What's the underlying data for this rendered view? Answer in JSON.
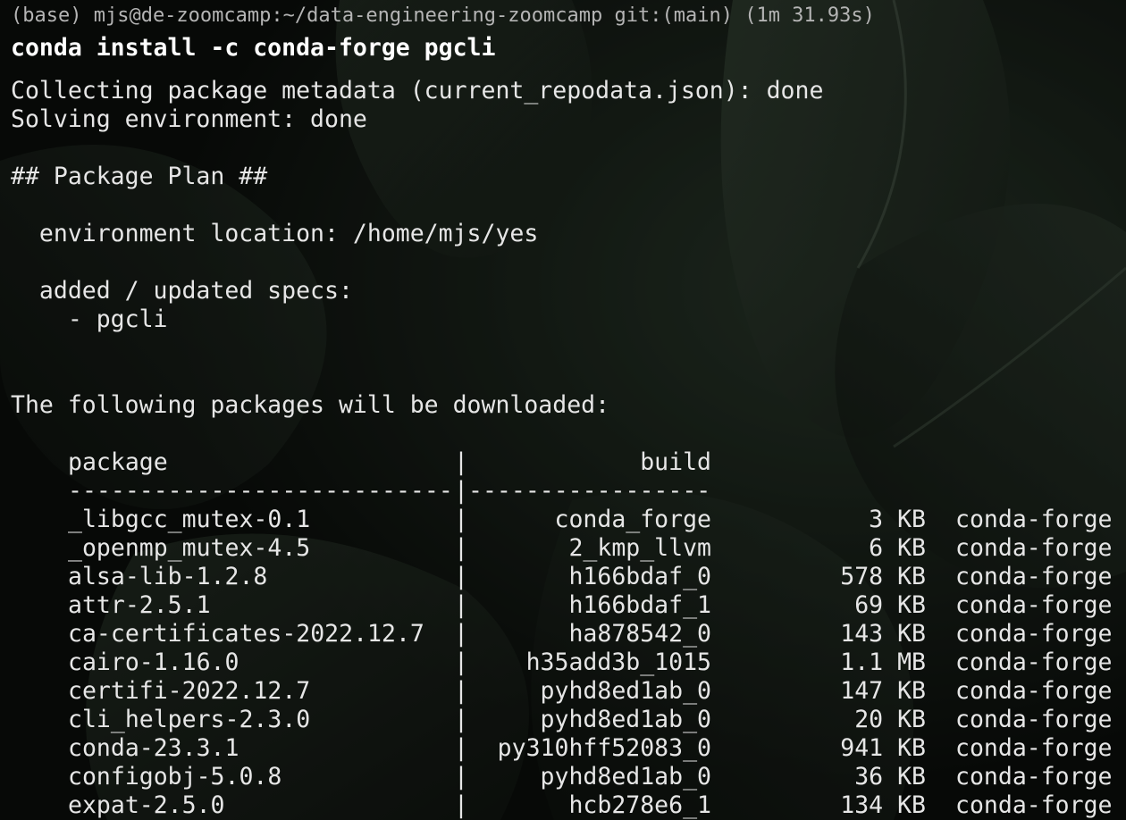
{
  "terminal": {
    "prompt": "(base) mjs@de-zoomcamp:~/data-engineering-zoomcamp git:(main) (1m 31.93s)",
    "command": "conda install -c conda-forge pgcli",
    "output_lines": [
      "Collecting package metadata (current_repodata.json): done",
      "Solving environment: done",
      "## Package Plan ##",
      "  environment location: /home/mjs/yes",
      "  added / updated specs:",
      "    - pgcli",
      "The following packages will be downloaded:"
    ],
    "table": {
      "header_package": "package",
      "header_sep": "|",
      "header_build": "build",
      "separator_package": "---------------------------",
      "separator_mid": "|",
      "separator_build": "-----------------",
      "divider": "|",
      "rows": [
        {
          "package": "_libgcc_mutex-0.1",
          "build": "conda_forge",
          "size": "3 KB",
          "channel": "conda-forge"
        },
        {
          "package": "_openmp_mutex-4.5",
          "build": "2_kmp_llvm",
          "size": "6 KB",
          "channel": "conda-forge"
        },
        {
          "package": "alsa-lib-1.2.8",
          "build": "h166bdaf_0",
          "size": "578 KB",
          "channel": "conda-forge"
        },
        {
          "package": "attr-2.5.1",
          "build": "h166bdaf_1",
          "size": "69 KB",
          "channel": "conda-forge"
        },
        {
          "package": "ca-certificates-2022.12.7",
          "build": "ha878542_0",
          "size": "143 KB",
          "channel": "conda-forge"
        },
        {
          "package": "cairo-1.16.0",
          "build": "h35add3b_1015",
          "size": "1.1 MB",
          "channel": "conda-forge"
        },
        {
          "package": "certifi-2022.12.7",
          "build": "pyhd8ed1ab_0",
          "size": "147 KB",
          "channel": "conda-forge"
        },
        {
          "package": "cli_helpers-2.3.0",
          "build": "pyhd8ed1ab_0",
          "size": "20 KB",
          "channel": "conda-forge"
        },
        {
          "package": "conda-23.3.1",
          "build": "py310hff52083_0",
          "size": "941 KB",
          "channel": "conda-forge"
        },
        {
          "package": "configobj-5.0.8",
          "build": "pyhd8ed1ab_0",
          "size": "36 KB",
          "channel": "conda-forge"
        },
        {
          "package": "expat-2.5.0",
          "build": "hcb278e6_1",
          "size": "134 KB",
          "channel": "conda-forge"
        }
      ]
    }
  }
}
